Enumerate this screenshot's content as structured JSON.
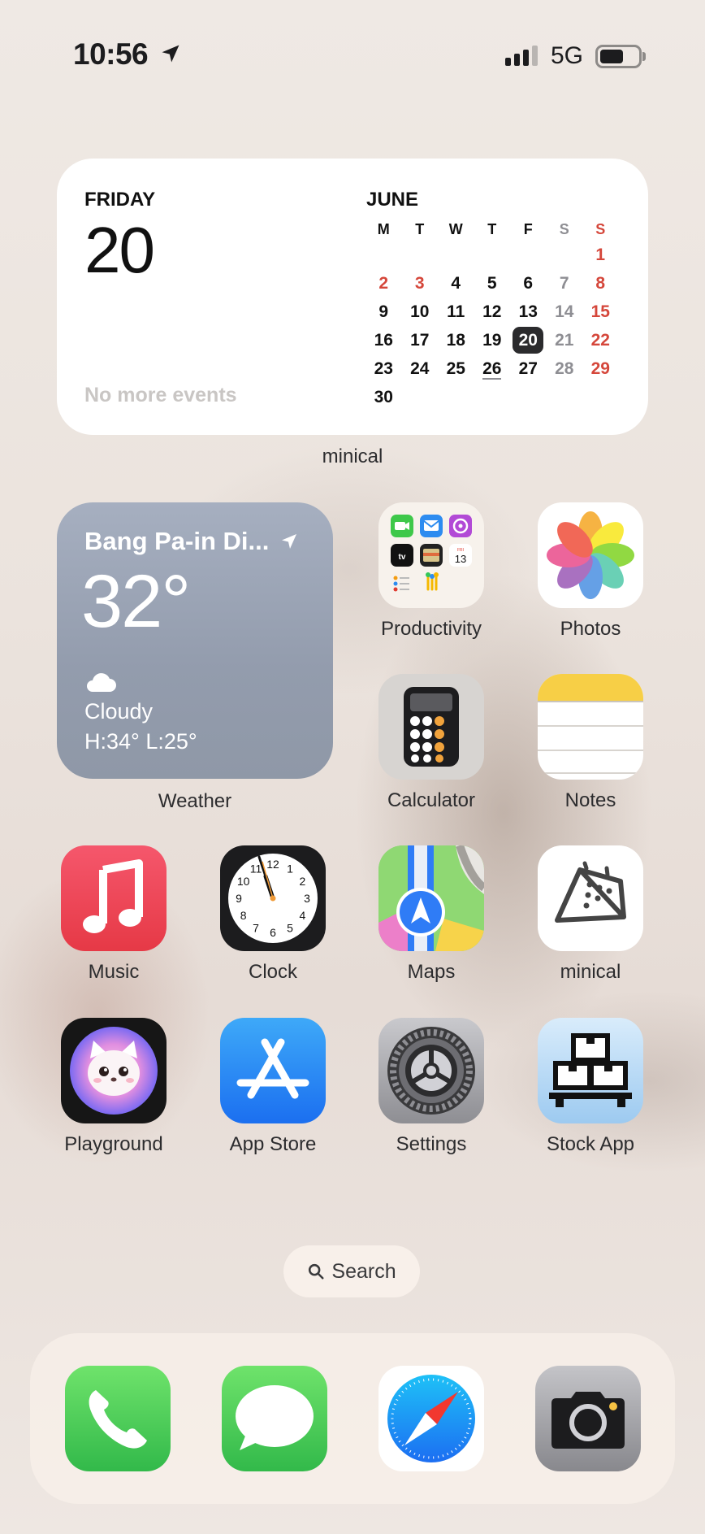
{
  "status_bar": {
    "time": "10:56",
    "network": "5G"
  },
  "calendar_widget": {
    "weekday": "FRIDAY",
    "day_number": "20",
    "events_text": "No more events",
    "month": "JUNE",
    "weekday_headers": [
      "M",
      "T",
      "W",
      "T",
      "F",
      "S",
      "S"
    ],
    "weeks": [
      [
        "",
        "",
        "",
        "",
        "",
        "",
        "1"
      ],
      [
        "2",
        "3",
        "4",
        "5",
        "6",
        "7",
        "8"
      ],
      [
        "9",
        "10",
        "11",
        "12",
        "13",
        "14",
        "15"
      ],
      [
        "16",
        "17",
        "18",
        "19",
        "20",
        "21",
        "22"
      ],
      [
        "23",
        "24",
        "25",
        "26",
        "27",
        "28",
        "29"
      ],
      [
        "30",
        "",
        "",
        "",
        "",
        "",
        ""
      ]
    ],
    "today": "20",
    "label": "minical"
  },
  "weather_widget": {
    "location": "Bang Pa-in Di...",
    "temperature": "32°",
    "condition": "Cloudy",
    "high_low": "H:34° L:25°",
    "label": "Weather"
  },
  "apps": {
    "productivity": "Productivity",
    "photos": "Photos",
    "calculator": "Calculator",
    "notes": "Notes",
    "music": "Music",
    "clock": "Clock",
    "maps": "Maps",
    "minical": "minical",
    "playground": "Playground",
    "app_store": "App Store",
    "settings": "Settings",
    "stock_app": "Stock App"
  },
  "folder_mini": {
    "calendar_day": "13"
  },
  "clock_numbers": [
    "12",
    "1",
    "2",
    "3",
    "4",
    "5",
    "6",
    "7",
    "8",
    "9",
    "10",
    "11"
  ],
  "search": {
    "label": "Search"
  },
  "dock": [
    "phone-icon",
    "messages-icon",
    "safari-icon",
    "camera-icon"
  ],
  "colors": {
    "weekend_red": "#d5473b",
    "music_red": "#ee4653",
    "phone_green": "#4cd964",
    "appstore_blue": "#1e8af5"
  }
}
